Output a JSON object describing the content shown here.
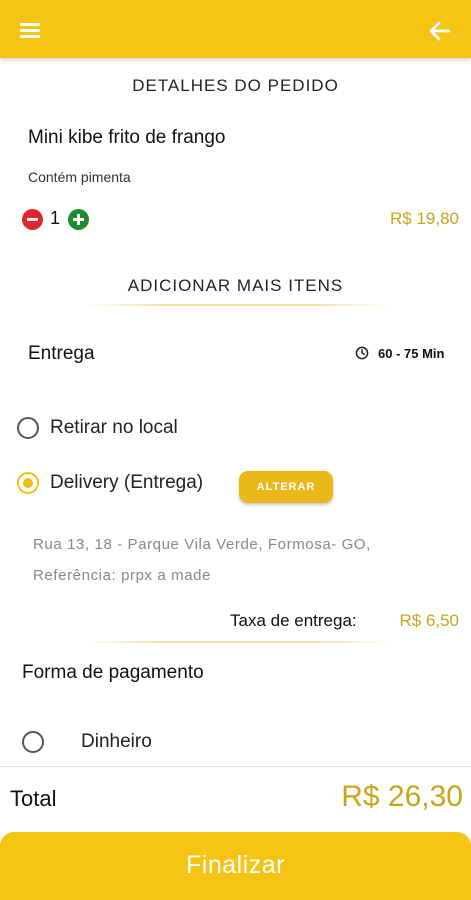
{
  "header": {
    "menu_icon": "hamburger-icon",
    "back_icon": "arrow-left-icon",
    "bg_color": "#f5c414"
  },
  "order_details": {
    "title": "DETALHES DO PEDIDO",
    "item": {
      "name": "Mini kibe frito de frango",
      "note": "Contém pimenta",
      "quantity": "1",
      "price": "R$ 19,80"
    }
  },
  "add_more_label": "ADICIONAR MAIS ITENS",
  "delivery": {
    "title": "Entrega",
    "time_icon": "clock-icon",
    "time": "60 - 75 Min",
    "options": [
      {
        "label": "Retirar no local",
        "selected": false
      },
      {
        "label": "Delivery (Entrega)",
        "selected": true
      }
    ],
    "alter_label": "ALTERAR",
    "address_line1": "Rua 13, 18 - Parque Vila Verde, Formosa- GO,",
    "address_line2": "Referência: prpx a made",
    "fee_label": "Taxa de entrega:",
    "fee_value": "R$ 6,50"
  },
  "payment": {
    "title": "Forma de pagamento",
    "options": [
      {
        "label": "Dinheiro",
        "selected": false
      }
    ]
  },
  "total": {
    "label": "Total",
    "value": "R$ 26,30"
  },
  "finish_label": "Finalizar",
  "colors": {
    "accent": "#f5c414",
    "price": "#c9a51c",
    "minus": "#e0262c",
    "plus": "#1e8b30"
  }
}
